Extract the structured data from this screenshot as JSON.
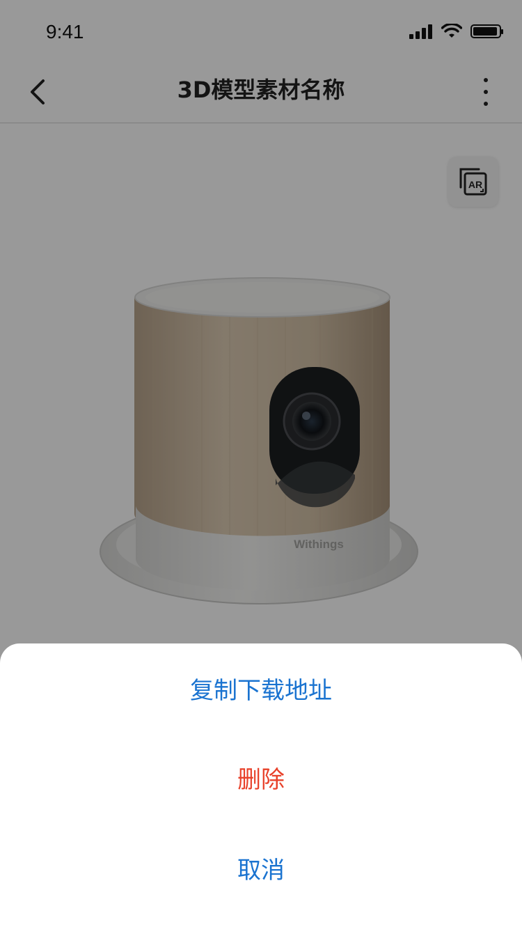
{
  "status_bar": {
    "time": "9:41"
  },
  "nav": {
    "title": "3D模型素材名称"
  },
  "ar_button": {
    "label": "AR"
  },
  "product": {
    "brand": "Withings"
  },
  "action_sheet": {
    "items": [
      {
        "label": "复制下载地址",
        "color": "#1a73d0"
      },
      {
        "label": "删除",
        "color": "#e8412a"
      },
      {
        "label": "取消",
        "color": "#1a73d0"
      }
    ]
  },
  "colors": {
    "overlay": "rgba(0,0,0,0.4)",
    "accent": "#1a73d0",
    "danger": "#e8412a"
  },
  "icons": [
    "back-arrow-icon",
    "more-vertical-icon",
    "ar-icon",
    "cellular-signal-icon",
    "wifi-icon",
    "battery-icon"
  ]
}
